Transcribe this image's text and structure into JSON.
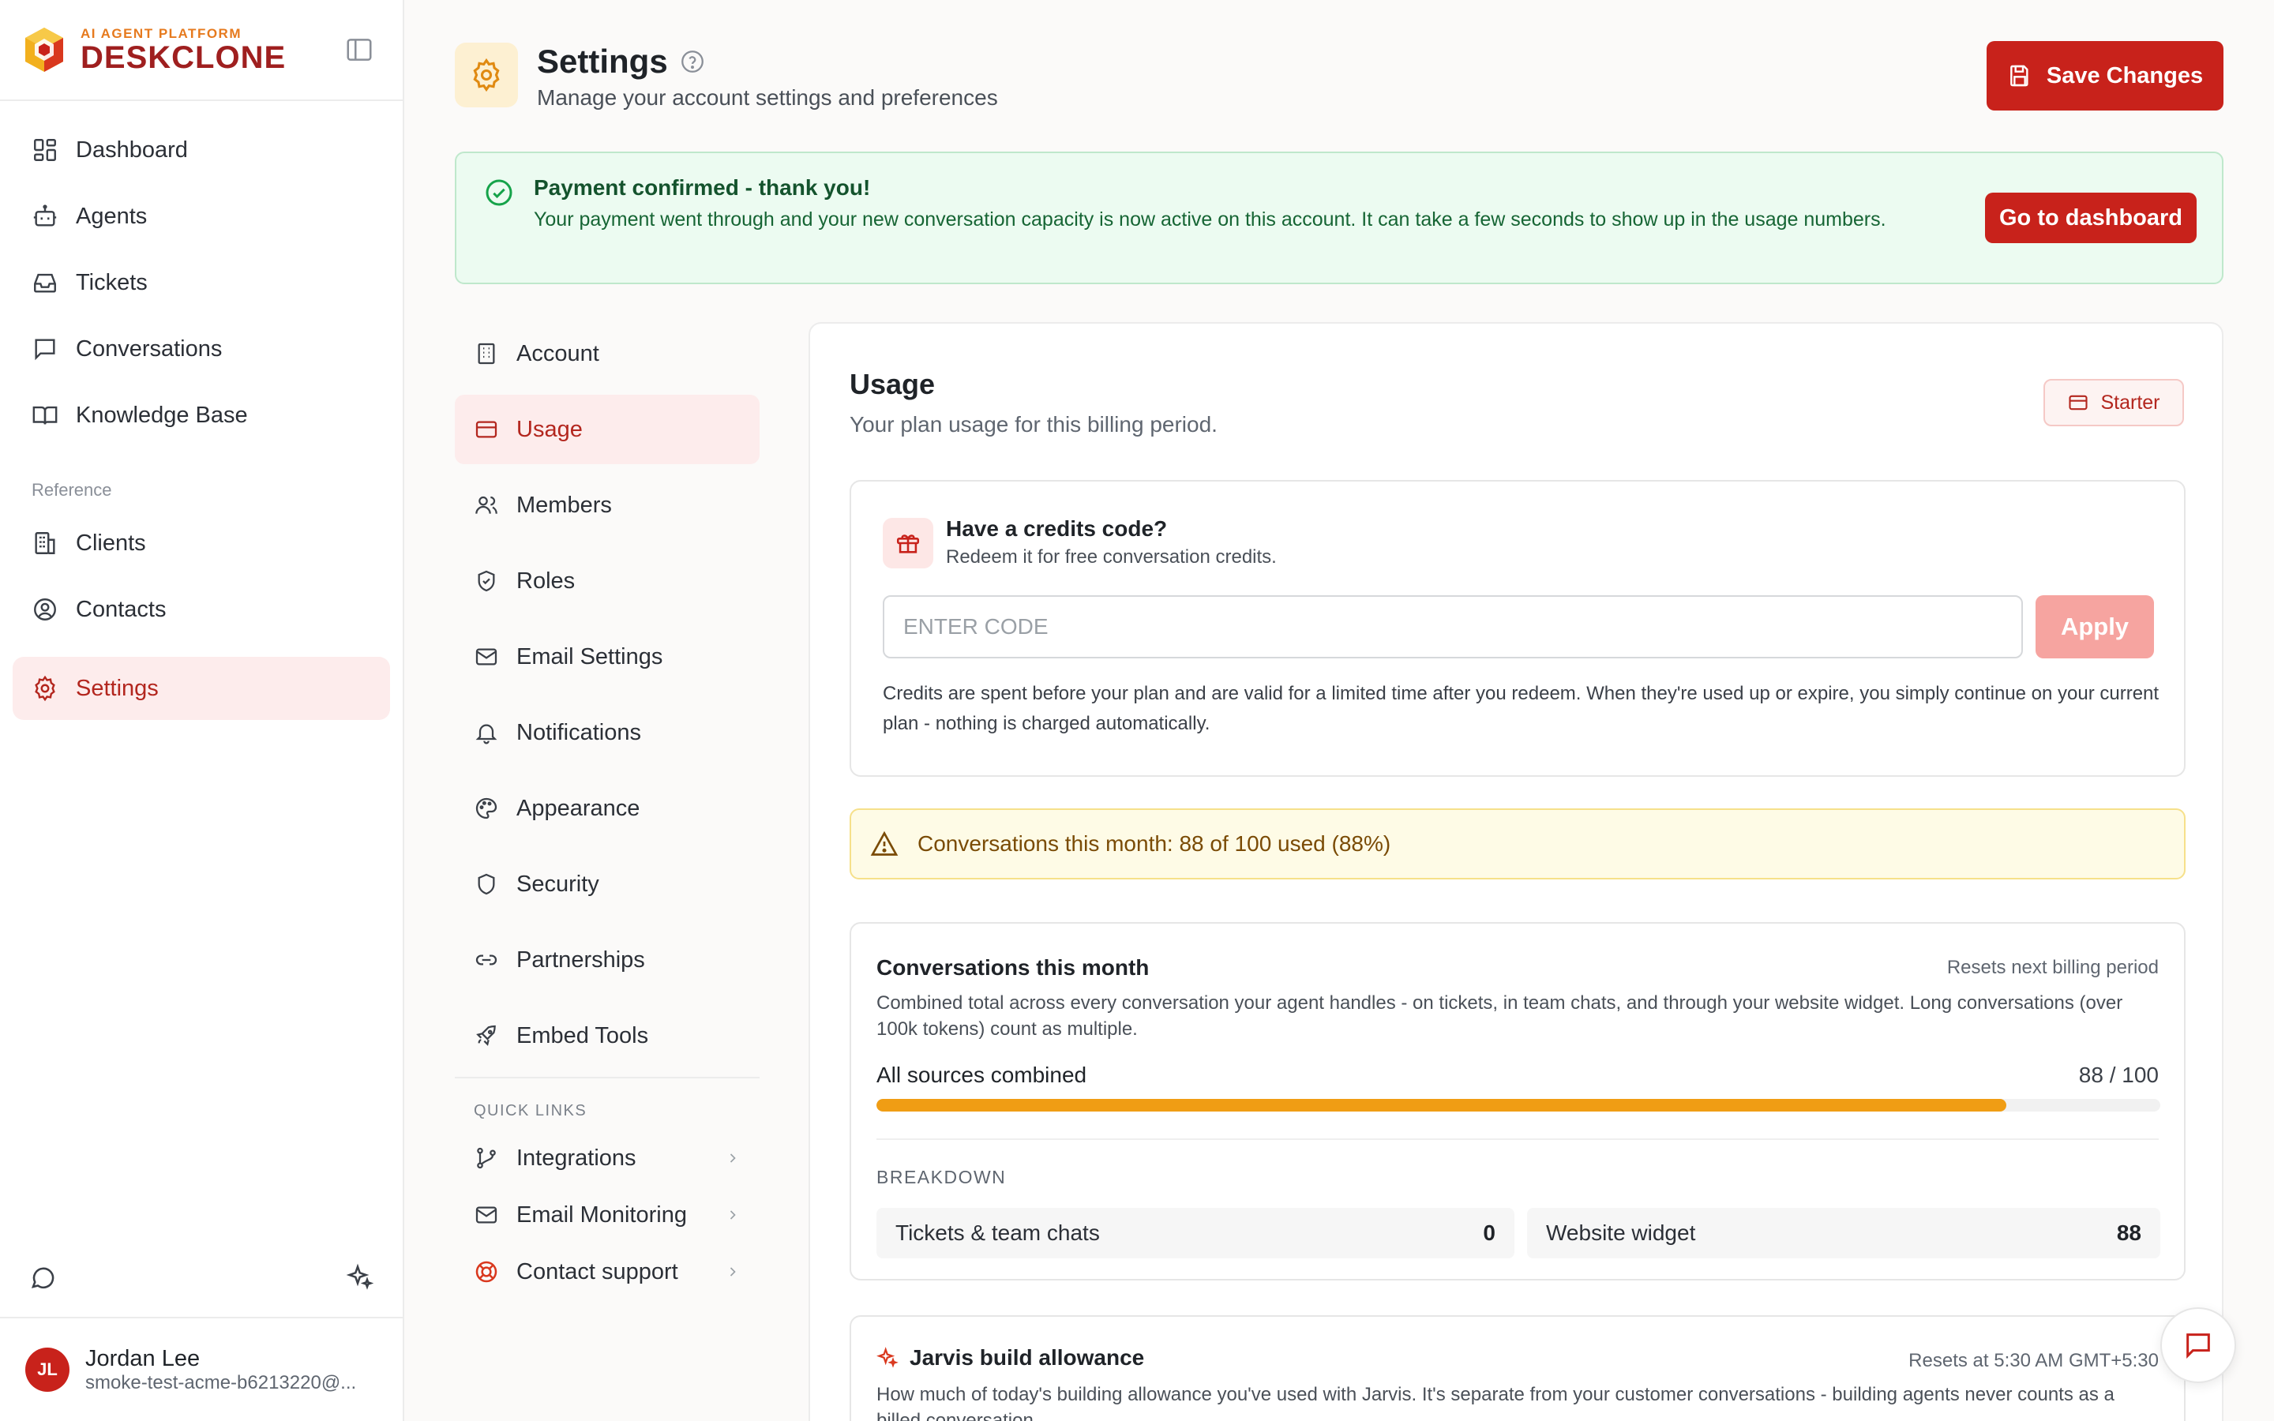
{
  "brand": {
    "tagline": "AI AGENT PLATFORM",
    "name": "DESKCLONE"
  },
  "sidebar": {
    "items": [
      {
        "label": "Dashboard",
        "icon": "grid-icon"
      },
      {
        "label": "Agents",
        "icon": "bot-icon"
      },
      {
        "label": "Tickets",
        "icon": "inbox-icon"
      },
      {
        "label": "Conversations",
        "icon": "message-icon"
      },
      {
        "label": "Knowledge Base",
        "icon": "book-icon"
      }
    ],
    "section_label": "Reference",
    "reference_items": [
      {
        "label": "Clients",
        "icon": "building-icon"
      },
      {
        "label": "Contacts",
        "icon": "user-circle-icon"
      }
    ],
    "settings_label": "Settings"
  },
  "user": {
    "initials": "JL",
    "name": "Jordan Lee",
    "email": "smoke-test-acme-b6213220@..."
  },
  "header": {
    "title": "Settings",
    "subtitle": "Manage your account settings and preferences",
    "save_label": "Save Changes"
  },
  "alert": {
    "title": "Payment confirmed - thank you!",
    "text": "Your payment went through and your new conversation capacity is now active on this account. It can take a few seconds to show up in the usage numbers.",
    "action": "Go to dashboard"
  },
  "subnav": {
    "items": [
      "Account",
      "Usage",
      "Members",
      "Roles",
      "Email Settings",
      "Notifications",
      "Appearance",
      "Security",
      "Partnerships",
      "Embed Tools"
    ],
    "active": "Usage",
    "quick_links_label": "QUICK LINKS",
    "quick_links": [
      "Integrations",
      "Email Monitoring",
      "Contact support"
    ]
  },
  "usage": {
    "title": "Usage",
    "subtitle": "Your plan usage for this billing period.",
    "plan": "Starter"
  },
  "credits": {
    "title": "Have a credits code?",
    "subtitle": "Redeem it for free conversation credits.",
    "placeholder": "ENTER CODE",
    "value": "",
    "apply_label": "Apply",
    "note": "Credits are spent before your plan and are valid for a limited time after you redeem. When they're used up or expire, you simply continue on your current plan - nothing is charged automatically."
  },
  "warning": {
    "text": "Conversations this month: 88 of 100 used (88%)"
  },
  "conversations": {
    "title": "Conversations this month",
    "reset": "Resets next billing period",
    "description": "Combined total across every conversation your agent handles - on tickets, in team chats, and through your website widget. Long conversations (over 100k tokens) count as multiple.",
    "all_label": "All sources combined",
    "count_label": "88 / 100",
    "used": 88,
    "limit": 100,
    "breakdown_label": "BREAKDOWN",
    "breakdown": [
      {
        "label": "Tickets & team chats",
        "value": "0"
      },
      {
        "label": "Website widget",
        "value": "88"
      }
    ]
  },
  "jarvis": {
    "title": "Jarvis build allowance",
    "reset": "Resets at 5:30 AM GMT+5:30",
    "description": "How much of today's building allowance you've used with Jarvis. It's separate from your customer conversations - building agents never counts as a billed conversation."
  },
  "colors": {
    "accent": "#c8221b",
    "progress": "#f09d14",
    "success_bg": "#ecfbf1",
    "warning_bg": "#fefbe6"
  }
}
